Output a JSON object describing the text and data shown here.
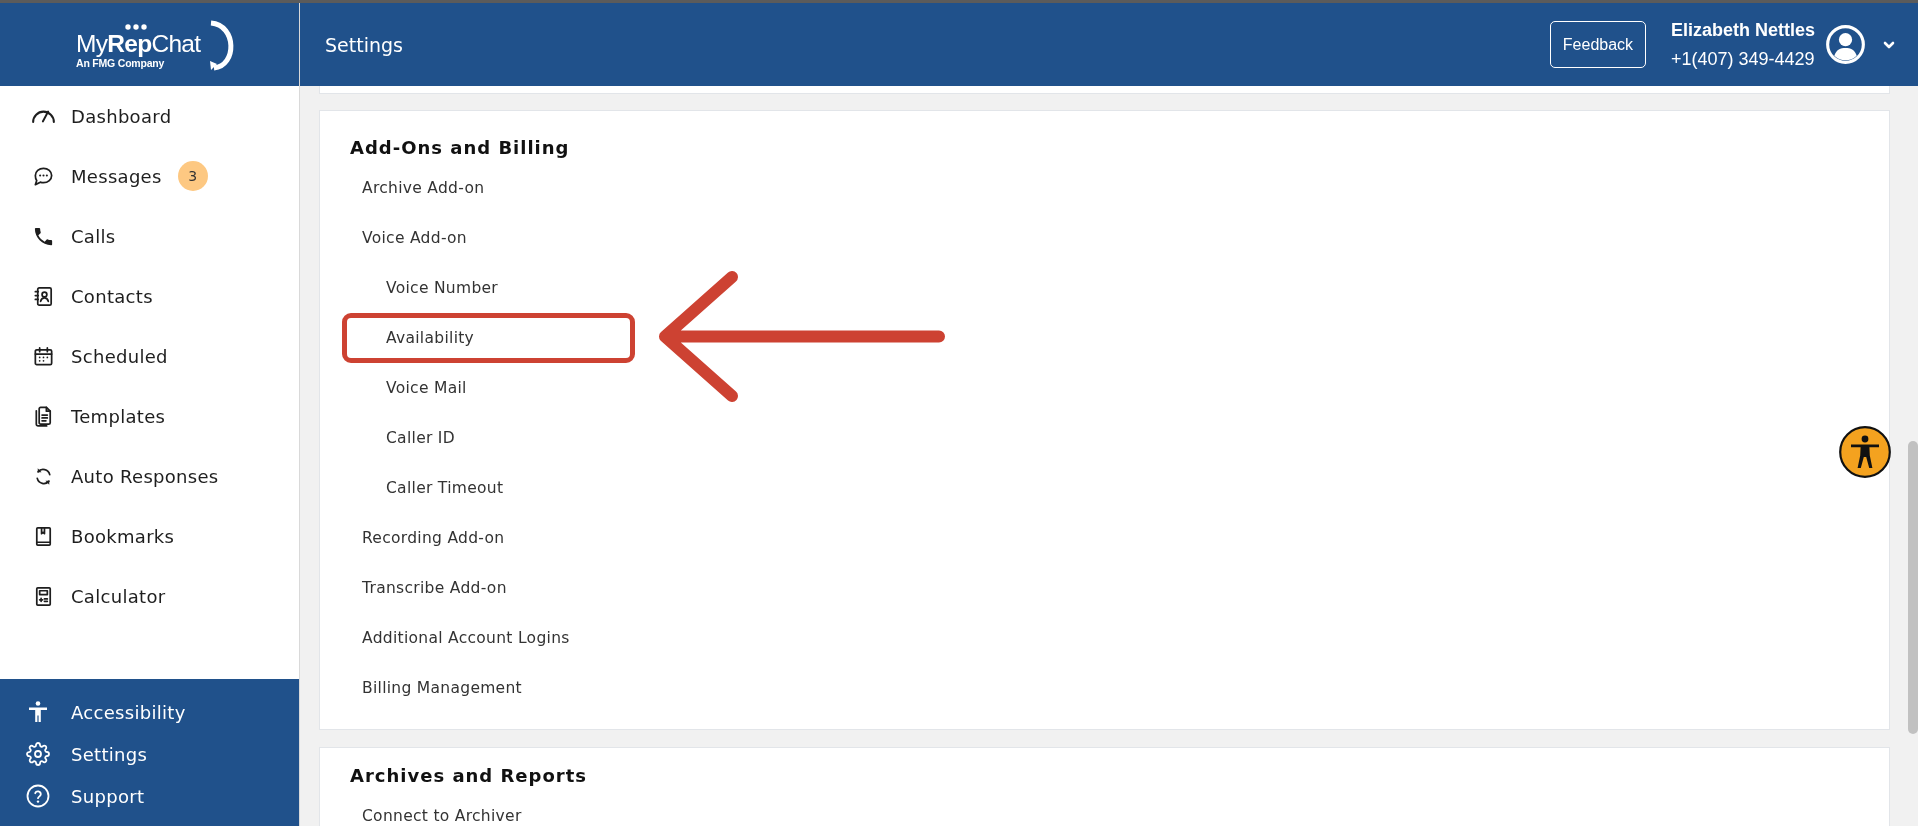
{
  "logo": {
    "wordmark": "My**Rep**Chat",
    "tagline": "An FMG Company"
  },
  "sidebar": {
    "items": [
      {
        "label": "Dashboard"
      },
      {
        "label": "Messages",
        "badge": "3"
      },
      {
        "label": "Calls"
      },
      {
        "label": "Contacts"
      },
      {
        "label": "Scheduled"
      },
      {
        "label": "Templates"
      },
      {
        "label": "Auto Responses"
      },
      {
        "label": "Bookmarks"
      },
      {
        "label": "Calculator"
      }
    ],
    "footer_items": [
      {
        "label": "Accessibility"
      },
      {
        "label": "Settings"
      },
      {
        "label": "Support"
      }
    ]
  },
  "header": {
    "title": "Settings",
    "feedback_button": "Feedback",
    "user": {
      "name": "Elizabeth Nettles",
      "phone": "+1(407) 349-4429"
    }
  },
  "sections": [
    {
      "title": "Add-Ons and Billing",
      "items": [
        {
          "label": "Archive Add-on",
          "highlighted": false
        },
        {
          "label": "Voice Add-on",
          "highlighted": false,
          "children": [
            {
              "label": "Voice Number",
              "highlighted": false
            },
            {
              "label": "Availability",
              "highlighted": true
            },
            {
              "label": "Voice Mail",
              "highlighted": false
            },
            {
              "label": "Caller ID",
              "highlighted": false
            },
            {
              "label": "Caller Timeout",
              "highlighted": false
            }
          ]
        },
        {
          "label": "Recording Add-on",
          "highlighted": false
        },
        {
          "label": "Transcribe Add-on",
          "highlighted": false
        },
        {
          "label": "Additional Account Logins",
          "highlighted": false
        },
        {
          "label": "Billing Management",
          "highlighted": false
        }
      ]
    },
    {
      "title": "Archives and Reports",
      "items": [
        {
          "label": "Connect to Archiver",
          "highlighted": false
        }
      ]
    }
  ]
}
